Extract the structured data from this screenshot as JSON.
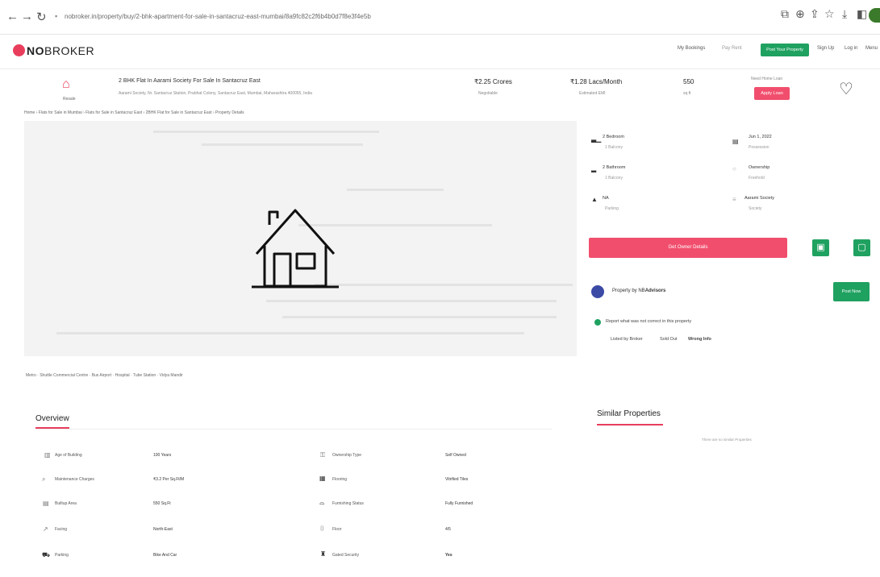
{
  "browser": {
    "url": "nobroker.in/property/buy/2-bhk-apartment-for-sale-in-santacruz-east-mumbai/8a9fc82c2f6b4b0d7f8e3f4e5b",
    "colors": {
      "profile": "#3a7a2a"
    }
  },
  "header": {
    "logo_no": "NO",
    "logo_broker": "BROKER",
    "my_bookings": "My Bookings",
    "pay_rent": "Pay Rent",
    "post_property": "Post Your Property",
    "sign_up": "Sign Up",
    "log_in": "Log in",
    "menu": "Menu",
    "brand_color": "#e83e5c"
  },
  "property": {
    "icon_label": "Resale",
    "title": "2 BHK Flat In Aarami Society For Sale In Santacruz East",
    "address": "Aarami Society, Nr. Santacruz Station, Prabhat Colony, Santacruz East, Mumbai, Maharashtra 400055, India",
    "price": "₹2.25 Crores",
    "price_sub": "Negotiable",
    "emi": "₹1.28 Lacs/Month",
    "emi_sub": "Estimated EMI",
    "area": "550",
    "area_sub": "sq.ft",
    "home_loan_label": "Need Home Loan",
    "apply_loan": "Apply Loan"
  },
  "breadcrumb": "Home › Flats for Sale in Mumbai › Flats for Sale in Santacruz East › 2BHK Flat for Sale in Santacruz East › Property Details",
  "amenity_strip": "Metro · Shuttle Commercial Centre · Bus Airport · Hospital · Tube Station · Vidya Mandir",
  "specs": [
    {
      "icon": "bed-icon",
      "glyph": "▃▁",
      "label": "2 Bedroom",
      "sub": "1 Balcony"
    },
    {
      "icon": "calendar-icon",
      "glyph": "▤",
      "label": "Jun 1, 2022",
      "sub": "Possession"
    },
    {
      "icon": "bath-icon",
      "glyph": "▂",
      "label": "2 Bathroom",
      "sub": "1 Balcony"
    },
    {
      "icon": "ownership-icon",
      "glyph": "○",
      "label": "Ownership",
      "sub": "Freehold"
    },
    {
      "icon": "parking-icon",
      "glyph": "▲",
      "label": "NA",
      "sub": "Parking"
    },
    {
      "icon": "society-icon",
      "glyph": "≡",
      "label": "Aarami Society",
      "sub": "Society"
    }
  ],
  "contact_button": "Get Owner Details",
  "promoted": {
    "text": "Property by NB",
    "text_bold": "Advisors",
    "button": "Post Now"
  },
  "report": {
    "text": "Report what was not correct in this property",
    "links": [
      "Listed by Broker",
      "Sold Out",
      "Wrong Info"
    ]
  },
  "overview": {
    "title": "Overview",
    "rows": [
      {
        "icon": "building-age-icon",
        "label": "Age of Building",
        "value": "100 Years",
        "icon2": "ownership-type-icon",
        "label2": "Ownership Type",
        "value2": "Self Owned"
      },
      {
        "icon": "maintenance-icon",
        "label": "Maintenance Charges",
        "value": "₹3.2 Per Sq.Ft/M",
        "icon2": "flooring-icon",
        "label2": "Flooring",
        "value2": "Vitrified Tiles"
      },
      {
        "icon": "builtup-icon",
        "label": "Builtup Area",
        "value": "550 Sq.Ft",
        "icon2": "furnishing-icon",
        "label2": "Furnishing Status",
        "value2": "Fully Furnished"
      },
      {
        "icon": "facing-icon",
        "label": "Facing",
        "value": "North-East",
        "icon2": "floor-icon",
        "label2": "Floor",
        "value2": "4/5"
      },
      {
        "icon": "parking-icon",
        "label": "Parking",
        "value": "Bike And Car",
        "icon2": "gated-security-icon",
        "label2": "Gated Security",
        "value2": "Yes"
      }
    ]
  },
  "similar": {
    "title": "Similar Properties",
    "empty": "There are no similar Properties"
  }
}
